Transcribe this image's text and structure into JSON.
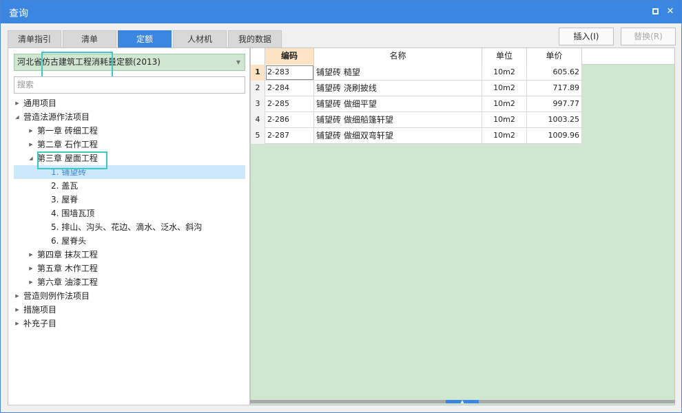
{
  "window": {
    "title": "查询"
  },
  "tabs": [
    {
      "label": "清单指引"
    },
    {
      "label": "清单"
    },
    {
      "label": "定额"
    },
    {
      "label": "人材机"
    },
    {
      "label": "我的数据"
    }
  ],
  "actions": {
    "insert": "插入(I)",
    "replace": "替换(R)"
  },
  "left": {
    "quota_library": "河北省仿古建筑工程消耗量定额(2013)",
    "search_placeholder": "搜索",
    "tree": [
      {
        "label": "通用项目",
        "expanded": false
      },
      {
        "label": "营造法源作法项目",
        "expanded": true
      },
      {
        "label": "第一章 砖细工程",
        "expanded": false
      },
      {
        "label": "第二章 石作工程",
        "expanded": false
      },
      {
        "label": "第三章 屋面工程",
        "expanded": true
      },
      {
        "label": "1. 铺望砖",
        "selected": true
      },
      {
        "label": "2. 盖瓦"
      },
      {
        "label": "3. 屋脊"
      },
      {
        "label": "4. 围墙瓦顶"
      },
      {
        "label": "5. 排山、沟头、花边、滴水、泛水、斜沟"
      },
      {
        "label": "6. 屋脊头"
      },
      {
        "label": "第四章 抹灰工程",
        "expanded": false
      },
      {
        "label": "第五章 木作工程",
        "expanded": false
      },
      {
        "label": "第六章 油漆工程",
        "expanded": false
      },
      {
        "label": "营造则例作法项目",
        "expanded": false
      },
      {
        "label": "措施项目",
        "expanded": false
      },
      {
        "label": "补充子目",
        "expanded": false
      }
    ]
  },
  "grid": {
    "columns": [
      "编码",
      "名称",
      "单位",
      "单价"
    ],
    "rows": [
      {
        "no": "1",
        "code": "2-283",
        "name": "铺望砖 糙望",
        "unit": "10m2",
        "price": "605.62"
      },
      {
        "no": "2",
        "code": "2-284",
        "name": "铺望砖 浇刷披线",
        "unit": "10m2",
        "price": "717.89"
      },
      {
        "no": "3",
        "code": "2-285",
        "name": "铺望砖 做细平望",
        "unit": "10m2",
        "price": "997.77"
      },
      {
        "no": "4",
        "code": "2-286",
        "name": "铺望砖 做细船篷轩望",
        "unit": "10m2",
        "price": "1003.25"
      },
      {
        "no": "5",
        "code": "2-287",
        "name": "铺望砖 做细双弯轩望",
        "unit": "10m2",
        "price": "1009.96"
      }
    ]
  },
  "colors": {
    "accent": "#3a86e0",
    "grid_background": "#cfe6cf",
    "highlight": "#3cc8c8"
  }
}
